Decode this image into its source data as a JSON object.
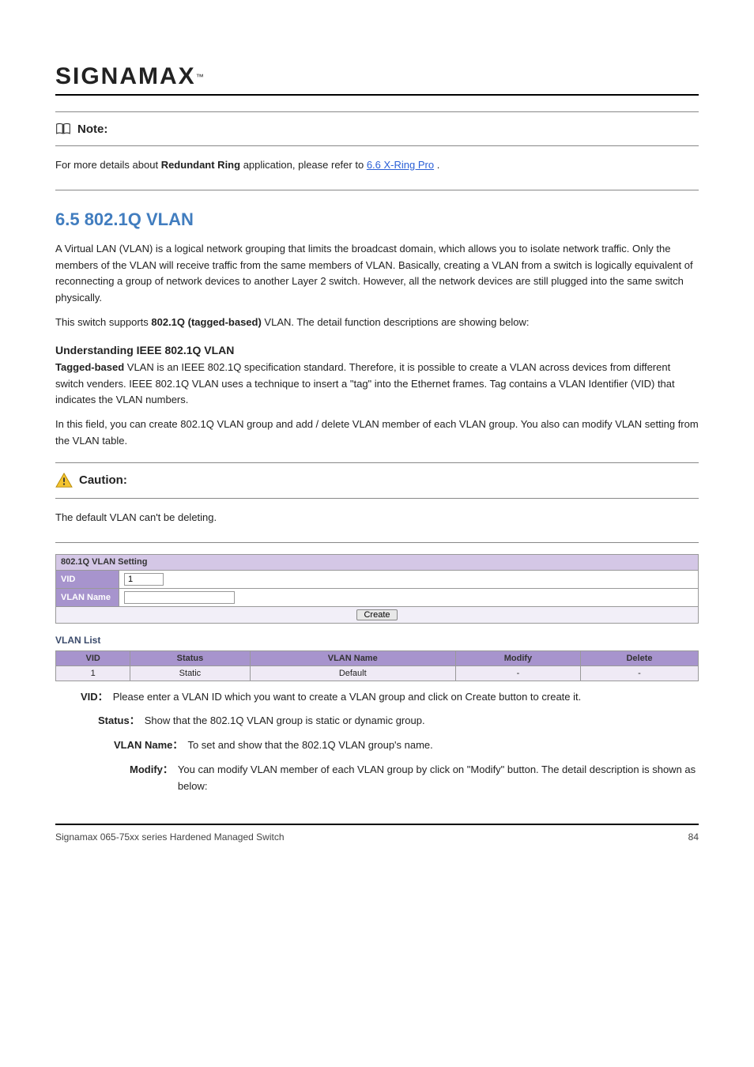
{
  "logo": {
    "text": "SIGNAMAX",
    "tm": "™"
  },
  "note": {
    "label": "Note:",
    "body_prefix": "For more details about ",
    "body_bold": "Redundant Ring",
    "body_mid": " application, please refer to ",
    "link": "6.6 X-Ring Pro",
    "body_suffix": "."
  },
  "section": {
    "title": "6.5 802.1Q VLAN",
    "desc1": "A Virtual LAN (VLAN) is a logical network grouping that limits the broadcast domain, which allows you to isolate network traffic. Only the members of the VLAN will receive traffic from the same members of VLAN. Basically, creating a VLAN from a switch is logically equivalent of reconnecting a group of network devices to another Layer 2 switch. However, all the network devices are still plugged into the same switch physically.",
    "desc2_prefix": "This switch supports ",
    "desc2_bold": "802.1Q (tagged-based)",
    "desc2_suffix": " VLAN. The detail function descriptions are showing below:",
    "subhead": "Understanding IEEE 802.1Q VLAN",
    "desc3_bold": "Tagged-based",
    "desc3_body": " VLAN is an IEEE 802.1Q specification standard. Therefore, it is possible to create a VLAN across devices from different switch venders. IEEE 802.1Q VLAN uses a technique to insert a \"tag\" into the Ethernet frames. Tag contains a VLAN Identifier (VID) that indicates the VLAN numbers.",
    "desc4": "In this field, you can create 802.1Q VLAN group and add / delete VLAN member of each VLAN group. You also can modify VLAN setting from the VLAN table."
  },
  "caution": {
    "label": "Caution:",
    "body": "The default VLAN can't be deleting."
  },
  "panel": {
    "setting_title": "802.1Q VLAN Setting",
    "vid_label": "VID",
    "vid_value": "1",
    "vlanname_label": "VLAN Name",
    "vlanname_value": "",
    "create_btn": "Create",
    "vlan_list_title": "VLAN List",
    "list_headers": [
      "VID",
      "Status",
      "VLAN Name",
      "Modify",
      "Delete"
    ],
    "list_row": [
      "1",
      "Static",
      "Default",
      "-",
      "-"
    ]
  },
  "items": {
    "vid_label": "VID",
    "vid_body": "Please enter a VLAN ID which you want to create a VLAN group and click on Create button to create it.",
    "status_label": "Status",
    "status_body": "Show that the 802.1Q VLAN group is static or dynamic group.",
    "vlanname_label": "VLAN Name",
    "vlanname_body": "To set and show that the 802.1Q VLAN group's name.",
    "modify_label": "Modify",
    "modify_body": "You can modify VLAN member of each VLAN group by click on \"Modify\" button. The detail description is shown as below:"
  },
  "footer": {
    "left": "Signamax 065-75xx series Hardened Managed Switch",
    "right": "84"
  }
}
